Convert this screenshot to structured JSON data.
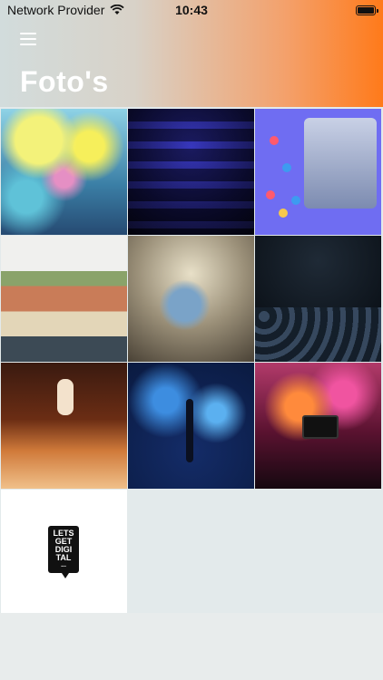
{
  "status_bar": {
    "provider": "Network Provider",
    "time": "10:43",
    "battery_level": 0.9
  },
  "header": {
    "title": "Foto's",
    "menu_icon": "hamburger-menu-icon",
    "gradient_colors": [
      "#d2dcdc",
      "#ff7a1a"
    ]
  },
  "photos": [
    {
      "subject": "color-festival"
    },
    {
      "subject": "empty-chairs"
    },
    {
      "subject": "livestream-stage-with-reactions"
    },
    {
      "subject": "festival-crowd-tent"
    },
    {
      "subject": "speaker-audience"
    },
    {
      "subject": "conference-audience"
    },
    {
      "subject": "concert-hands"
    },
    {
      "subject": "stage-microphone"
    },
    {
      "subject": "phone-recording-concert"
    },
    {
      "subject": "lets-get-digital-logo",
      "logo_text": [
        "LETS",
        "GET",
        "DIGI",
        "TAL"
      ]
    }
  ]
}
